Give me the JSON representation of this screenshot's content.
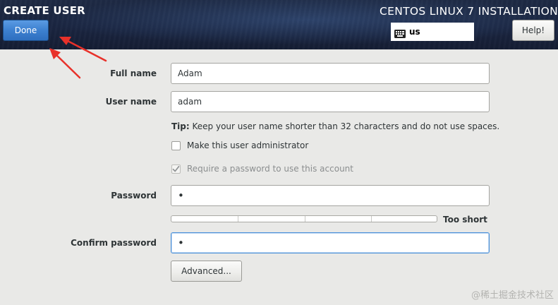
{
  "header": {
    "screen_title": "CREATE USER",
    "install_title": "CENTOS LINUX 7 INSTALLATION",
    "done_label": "Done",
    "keyboard_layout": "us",
    "help_label": "Help!"
  },
  "form": {
    "full_name": {
      "label": "Full name",
      "value": "Adam"
    },
    "user_name": {
      "label": "User name",
      "value": "adam"
    },
    "tip": {
      "prefix": "Tip:",
      "text": " Keep your user name shorter than 32 characters and do not use spaces."
    },
    "make_admin": {
      "label": "Make this user administrator",
      "checked": false
    },
    "require_password": {
      "label": "Require a password to use this account",
      "checked": true,
      "disabled": true
    },
    "password": {
      "label": "Password",
      "value": "•"
    },
    "strength": {
      "text": "Too short",
      "level": 0
    },
    "confirm_password": {
      "label": "Confirm password",
      "value": "•"
    },
    "advanced_label": "Advanced..."
  },
  "icons": {
    "keyboard": "keyboard-icon",
    "checkmark": "checkmark-icon"
  },
  "colors": {
    "header_bg": "#1a2540",
    "accent": "#3d80d0",
    "annotation_arrow": "#e8312a",
    "page_bg": "#e9e9e7"
  },
  "watermark": "@稀土掘金技术社区"
}
